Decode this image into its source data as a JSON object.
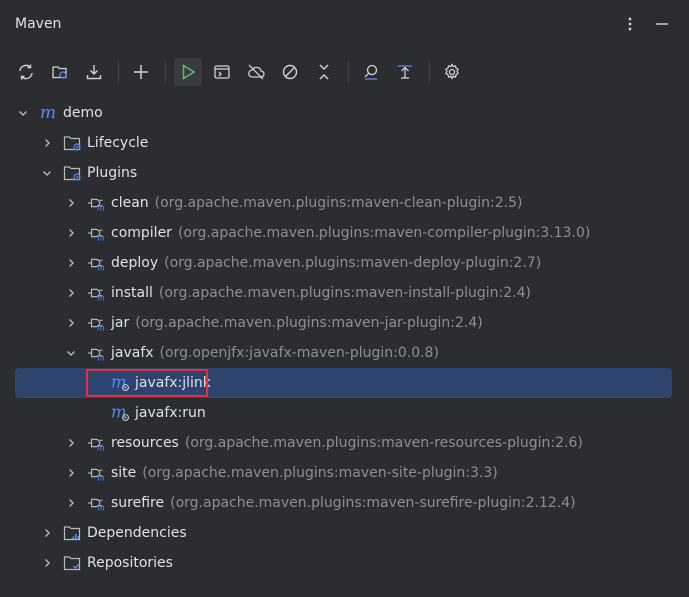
{
  "panel": {
    "title": "Maven"
  },
  "toolbar": {
    "buttons": [
      {
        "icon": "reload-icon",
        "name": "reload-all-button"
      },
      {
        "icon": "reload-project-icon",
        "name": "reload-project-button"
      },
      {
        "icon": "download-icon",
        "name": "download-sources-button"
      },
      {
        "icon": "plus-icon",
        "name": "add-project-button"
      },
      {
        "icon": "run-icon",
        "name": "run-button"
      },
      {
        "icon": "execute-goal-icon",
        "name": "execute-goal-button"
      },
      {
        "icon": "offline-icon",
        "name": "toggle-offline-button"
      },
      {
        "icon": "skip-tests-icon",
        "name": "skip-tests-button"
      },
      {
        "icon": "collapse-icon",
        "name": "collapse-all-button"
      },
      {
        "icon": "analyze-deps-icon",
        "name": "analyze-dependencies-button"
      },
      {
        "icon": "show-deps-icon",
        "name": "show-dependencies-button"
      },
      {
        "icon": "settings-icon",
        "name": "settings-button"
      }
    ]
  },
  "tree": {
    "root": "demo",
    "lifecycle": "Lifecycle",
    "plugins": "Plugins",
    "plugin_items": [
      {
        "name": "clean",
        "coord": "(org.apache.maven.plugins:maven-clean-plugin:2.5)"
      },
      {
        "name": "compiler",
        "coord": "(org.apache.maven.plugins:maven-compiler-plugin:3.13.0)"
      },
      {
        "name": "deploy",
        "coord": "(org.apache.maven.plugins:maven-deploy-plugin:2.7)"
      },
      {
        "name": "install",
        "coord": "(org.apache.maven.plugins:maven-install-plugin:2.4)"
      },
      {
        "name": "jar",
        "coord": "(org.apache.maven.plugins:maven-jar-plugin:2.4)"
      },
      {
        "name": "javafx",
        "coord": "(org.openjfx:javafx-maven-plugin:0.0.8)"
      },
      {
        "name": "resources",
        "coord": "(org.apache.maven.plugins:maven-resources-plugin:2.6)"
      },
      {
        "name": "site",
        "coord": "(org.apache.maven.plugins:maven-site-plugin:3.3)"
      },
      {
        "name": "surefire",
        "coord": "(org.apache.maven.plugins:maven-surefire-plugin:2.12.4)"
      }
    ],
    "goals": [
      "javafx:jlink",
      "javafx:run"
    ],
    "dependencies": "Dependencies",
    "repositories": "Repositories"
  },
  "colors": {
    "selection": "#2e436e",
    "highlight": "#e0333b",
    "maven_blue": "#548af7",
    "run_green": "#5fb865"
  }
}
